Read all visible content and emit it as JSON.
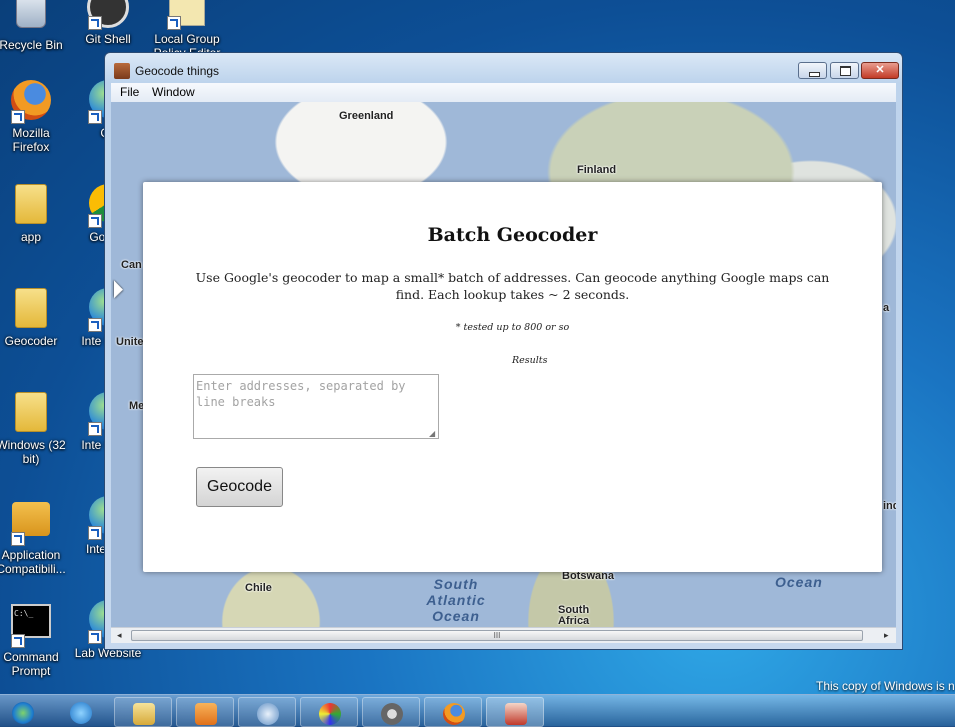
{
  "desktop": {
    "icons": [
      {
        "label": "Recycle Bin"
      },
      {
        "label": "Git Shell"
      },
      {
        "label": "Local Group Policy Editor"
      },
      {
        "label": "Mozilla Firefox"
      },
      {
        "label": "Git"
      },
      {
        "label": "app"
      },
      {
        "label": "Go Chi"
      },
      {
        "label": "Geocoder"
      },
      {
        "label": "Inte Explo"
      },
      {
        "label": "Windows (32 bit)"
      },
      {
        "label": "Inte Explo"
      },
      {
        "label": "Application Compatibili..."
      },
      {
        "label": "Inte Exp"
      },
      {
        "label": "Command Prompt"
      },
      {
        "label": "Lab Website"
      }
    ],
    "watermark": "This copy of Windows is n"
  },
  "window": {
    "title": "Geocode things",
    "menu": [
      "File",
      "Window"
    ],
    "controls": {
      "minimize": "",
      "maximize": "",
      "close": "✕"
    }
  },
  "map": {
    "labels": [
      "Greenland",
      "Finland",
      "Can",
      "Unite",
      "Me",
      "Chile",
      "Botswana",
      "South Africa",
      "a",
      "ind"
    ],
    "oceans": [
      "South Atlantic Ocean",
      "Ocean"
    ]
  },
  "dialog": {
    "title": "Batch Geocoder",
    "description": "Use Google's geocoder to map a small* batch of addresses. Can geocode anything Google maps can find. Each lookup takes ~ 2 seconds.",
    "note": "* tested up to 800 or so",
    "results_label": "Results",
    "input": {
      "placeholder": "Enter addresses, separated by line breaks",
      "value": ""
    },
    "button_label": "Geocode"
  },
  "scrollbar": {
    "thumb_grip": "III",
    "left_arrow": "◂",
    "right_arrow": "▸"
  },
  "taskbar": {
    "items": [
      "start",
      "internet-explorer",
      "explorer",
      "media-player",
      "app",
      "paint",
      "settings",
      "firefox",
      "app-pin"
    ]
  }
}
